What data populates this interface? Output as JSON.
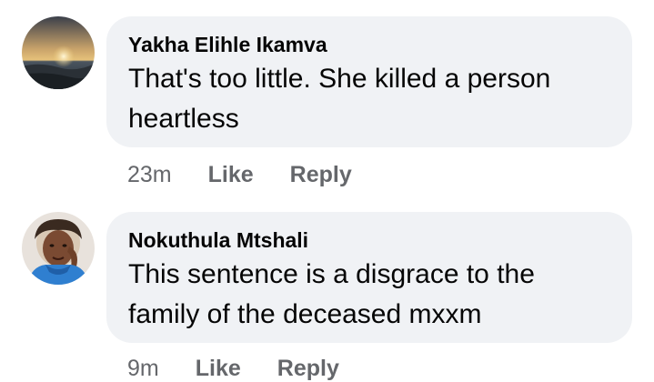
{
  "comments": [
    {
      "author": "Yakha Elihle Ikamva",
      "text_line1": "That's too little. She killed a person",
      "text_line2": "heartless",
      "time": "23m",
      "like_label": "Like",
      "reply_label": "Reply",
      "avatar_icon": "sunset-photo-avatar"
    },
    {
      "author": "Nokuthula Mtshali",
      "text_line1": "This sentence is a disgrace to the",
      "text_line2": "family of the deceased mxxm",
      "time": "9m",
      "like_label": "Like",
      "reply_label": "Reply",
      "avatar_icon": "woman-portrait-avatar"
    }
  ],
  "colors": {
    "bubble_bg": "#f0f2f5",
    "text": "#050505",
    "meta": "#65676b"
  }
}
